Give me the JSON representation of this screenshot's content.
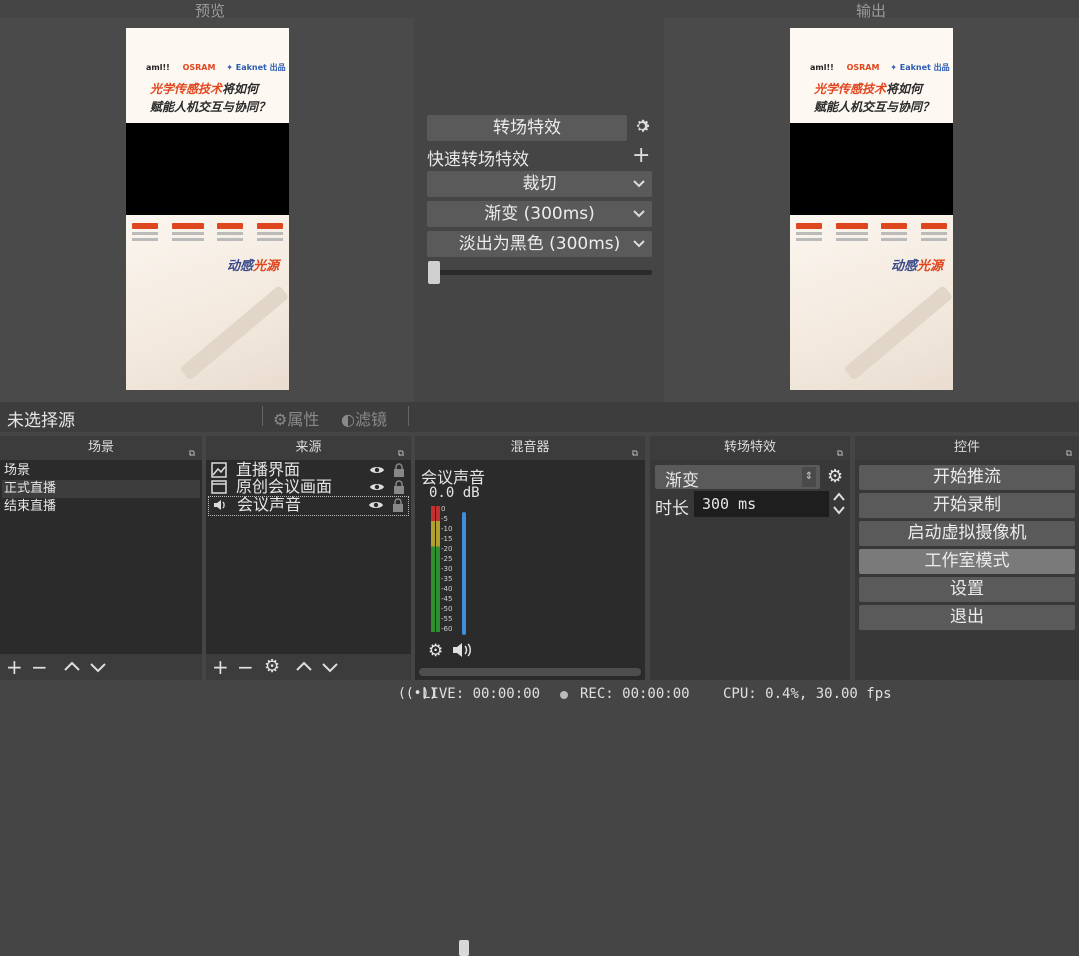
{
  "studio": {
    "preview_label": "预览",
    "program_label": "输出"
  },
  "canvas": {
    "logo_parts": [
      "aml!!",
      "OSRAM",
      "✦ Eaknet 出品"
    ],
    "headline_line1_red": "光学传感技术",
    "headline_line1_rest": "将如何",
    "headline_line2": "赋能人机交互与协同？",
    "slogan_a": "动感",
    "slogan_b": "光源"
  },
  "transitions": {
    "button_label": "转场特效",
    "quick_label": "快速转场特效",
    "items": [
      "裁切",
      "渐变 (300ms)",
      "淡出为黑色 (300ms)"
    ],
    "tbar_value": 0.0
  },
  "source_bar": {
    "no_source": "未选择源",
    "properties": "属性",
    "filters": "滤镜"
  },
  "scenes": {
    "title": "场景",
    "items": [
      "场景",
      "正式直播",
      "结束直播"
    ],
    "selected_index": 1
  },
  "sources": {
    "title": "来源",
    "items": [
      {
        "label": "直播界面",
        "icon": "image-icon"
      },
      {
        "label": "原创会议画面",
        "icon": "window-capture-icon"
      },
      {
        "label": "会议声音",
        "icon": "audio-icon"
      }
    ]
  },
  "mixer": {
    "title": "混音器",
    "channel_name": "会议声音",
    "level": "0.0 dB",
    "scale": [
      "0",
      "-5",
      "-10",
      "-15",
      "-20",
      "-25",
      "-30",
      "-35",
      "-40",
      "-45",
      "-50",
      "-55",
      "-60"
    ],
    "volume_fraction": 1.0
  },
  "transition_dock": {
    "title": "转场特效",
    "selected": "渐变",
    "duration_label": "时长",
    "duration_value": "300 ms"
  },
  "controls": {
    "title": "控件",
    "buttons": [
      "开始推流",
      "开始录制",
      "启动虚拟摄像机",
      "工作室模式",
      "设置",
      "退出"
    ],
    "active_index": 3
  },
  "status_bar": {
    "live": "LIVE: 00:00:00",
    "rec": "REC: 00:00:00",
    "cpu": "CPU: 0.4%, 30.00 fps"
  }
}
